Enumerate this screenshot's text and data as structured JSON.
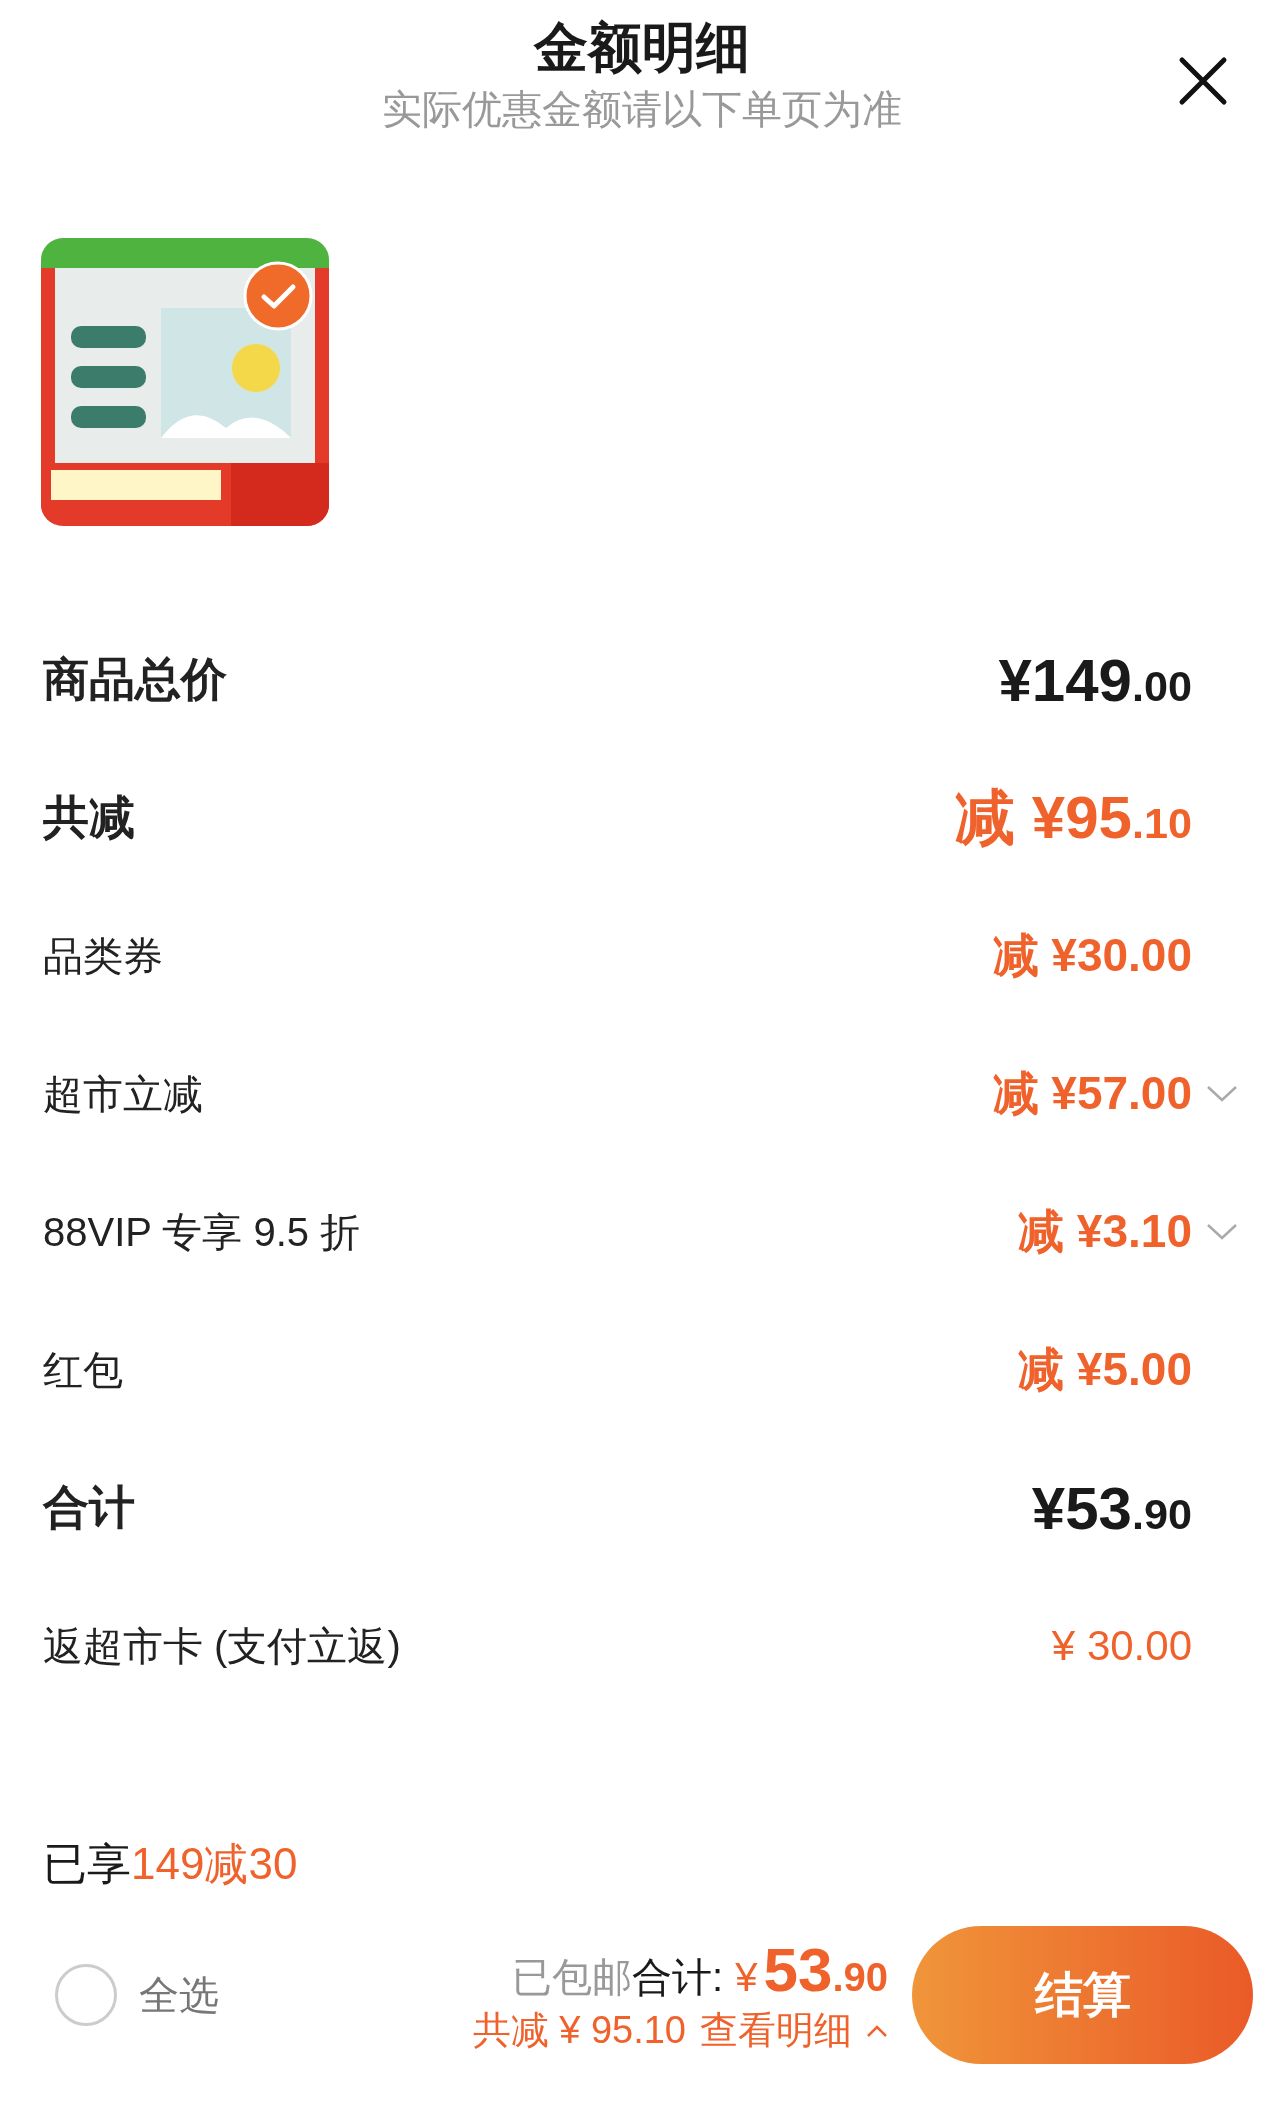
{
  "header": {
    "title": "金额明细",
    "subtitle": "实际优惠金额请以下单页为准"
  },
  "product": {
    "kind": "picture",
    "checked": true
  },
  "lines": [
    {
      "kind": "total",
      "label": "商品总价",
      "main": "¥149",
      "cents": ".00",
      "expandable": false
    },
    {
      "kind": "discount_total",
      "label": "共减",
      "main": "减 ¥95",
      "cents": ".10",
      "expandable": false
    },
    {
      "kind": "discount",
      "label": "品类券",
      "main": "减 ¥30.00",
      "expandable": false
    },
    {
      "kind": "discount",
      "label": "超市立减",
      "main": "减 ¥57.00",
      "expandable": true
    },
    {
      "kind": "discount",
      "label": "88VIP 专享 9.5 折",
      "main": "减 ¥3.10",
      "expandable": true
    },
    {
      "kind": "discount",
      "label": "红包",
      "main": "减 ¥5.00",
      "expandable": false
    },
    {
      "kind": "total",
      "label": "合计",
      "main": "¥53",
      "cents": ".90",
      "expandable": false
    },
    {
      "kind": "cashback",
      "label": "返超市卡 (支付立返)",
      "main": "¥ 30.00",
      "expandable": false
    }
  ],
  "promo": {
    "label": "已享",
    "value": "149减30"
  },
  "footer": {
    "select_all": {
      "label": "全选",
      "checked": false
    },
    "shipping": "已包邮",
    "total_label": "合计:",
    "currency": "¥",
    "total_main": "53",
    "total_cents": ".90",
    "saved": "共减 ¥ 95.10",
    "details_link": "查看明细",
    "checkout": "结算"
  }
}
